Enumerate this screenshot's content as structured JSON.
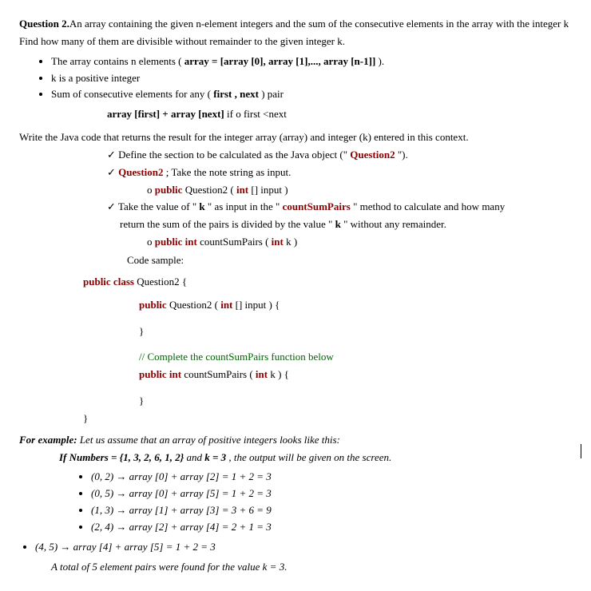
{
  "q": {
    "title_label": "Question 2.",
    "title_rest": "An array containing the given n-element integers and the sum of the consecutive elements in the array with the integer k",
    "line2": "Find how many of them are divisible without remainder to the given integer k.",
    "bullets": [
      {
        "prefix": "The array contains n elements ( ",
        "bold1": "array = [array [0], array [1],..., array [n-1]]",
        "suffix": " )."
      },
      {
        "plain": "k is a positive integer"
      },
      {
        "prefix": "Sum of consecutive elements for any ( ",
        "bold1": "first , next",
        "suffix": " ) pair"
      }
    ],
    "pair_line_pre": "array [first] + array [next]",
    "pair_line_mid": " if ",
    "pair_line_post": "o first <next",
    "write_line": "Write the Java code that returns the result for the integer array (array) and integer (k) entered in this context.",
    "ins1_pre": "Define the section to be calculated as the Java object (\" ",
    "ins1_red": "Question2",
    "ins1_post": " \").",
    "ins2_red": "Question2",
    "ins2_post": " ; Take the note string as input.",
    "ins2_o_pre": "public ",
    "ins2_o_mid": "Question2 ( ",
    "ins2_o_bold": "int",
    "ins2_o_end": " [] input )",
    "ins3_pre": "Take the value of \" ",
    "ins3_k1": "k",
    "ins3_mid1": " \" as input in the \" ",
    "ins3_csp": "countSumPairs",
    "ins3_mid2": " \" method to calculate and how many",
    "ins3_line2_pre": "return the sum of the pairs is divided by the value \" ",
    "ins3_k2": "k",
    "ins3_line2_post": " \" without any remainder.",
    "ins3_o_pre": "public int ",
    "ins3_o_mid": "countSumPairs ( ",
    "ins3_o_bold": "int",
    "ins3_o_end": " k )",
    "code_sample": "Code sample:",
    "cls_pre": "public class ",
    "cls_name": "Question2 {",
    "ctor_pre": "public ",
    "ctor_mid": "Question2 ( ",
    "ctor_bold": "int",
    "ctor_end": " [] input ) {",
    "brace_close": "}",
    "comment": "// Complete the countSumPairs function below",
    "meth_pre": "public int ",
    "meth_mid": "countSumPairs ( ",
    "meth_bold": "int",
    "meth_end": " k ) {",
    "ex_label": "For example:",
    "ex_rest": " Let us assume that an array of positive integers looks like this:",
    "ifnum_pre": "If Numbers = {1, 3, 2, 6, 1, 2}",
    "ifnum_mid": " and ",
    "ifnum_k": "k = 3",
    "ifnum_end": " , the output will be given on the screen.",
    "examples": [
      "(0, 2) → array [0] + array [2] = 1 + 2 = 3",
      "(0, 5) → array [0] + array [5] = 1 + 2 = 3",
      "(1, 3) → array [1] + array [3] = 3 + 6 = 9",
      "(2, 4) → array [2] + array [4] = 2 + 1 = 3"
    ],
    "example_last": "(4, 5) → array [4] + array [5] = 1 + 2 = 3",
    "total_line": "A total of 5 element pairs were found for the value k = 3."
  }
}
